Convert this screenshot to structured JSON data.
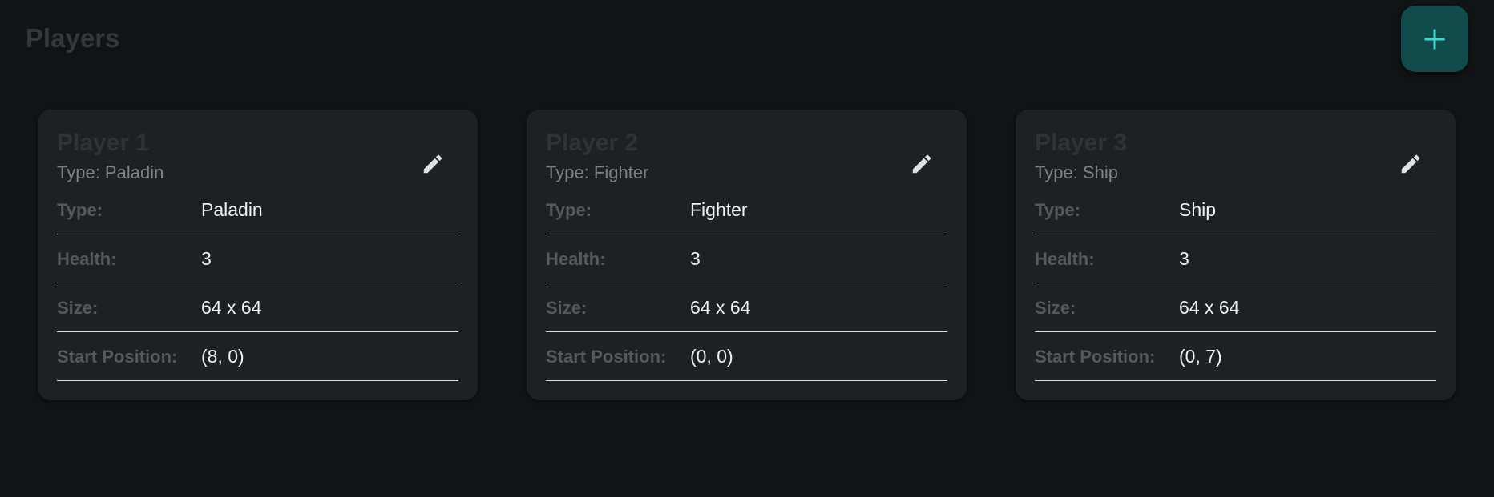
{
  "page": {
    "title": "Players"
  },
  "fab": {
    "icon": "plus-icon",
    "color": "#124b4c",
    "icon_color": "#3fd6d0"
  },
  "players": [
    {
      "name": "Player 1",
      "subtitle": "Type: Paladin",
      "edit_icon": "pencil-icon",
      "rows": [
        {
          "label": "Type:",
          "value": "Paladin"
        },
        {
          "label": "Health:",
          "value": "3"
        },
        {
          "label": "Size:",
          "value": "64 x 64"
        },
        {
          "label": "Start Position:",
          "value": "(8, 0)"
        }
      ]
    },
    {
      "name": "Player 2",
      "subtitle": "Type: Fighter",
      "edit_icon": "pencil-icon",
      "rows": [
        {
          "label": "Type:",
          "value": "Fighter"
        },
        {
          "label": "Health:",
          "value": "3"
        },
        {
          "label": "Size:",
          "value": "64 x 64"
        },
        {
          "label": "Start Position:",
          "value": "(0, 0)"
        }
      ]
    },
    {
      "name": "Player 3",
      "subtitle": "Type: Ship",
      "edit_icon": "pencil-icon",
      "rows": [
        {
          "label": "Type:",
          "value": "Ship"
        },
        {
          "label": "Health:",
          "value": "3"
        },
        {
          "label": "Size:",
          "value": "64 x 64"
        },
        {
          "label": "Start Position:",
          "value": "(0, 7)"
        }
      ]
    }
  ]
}
